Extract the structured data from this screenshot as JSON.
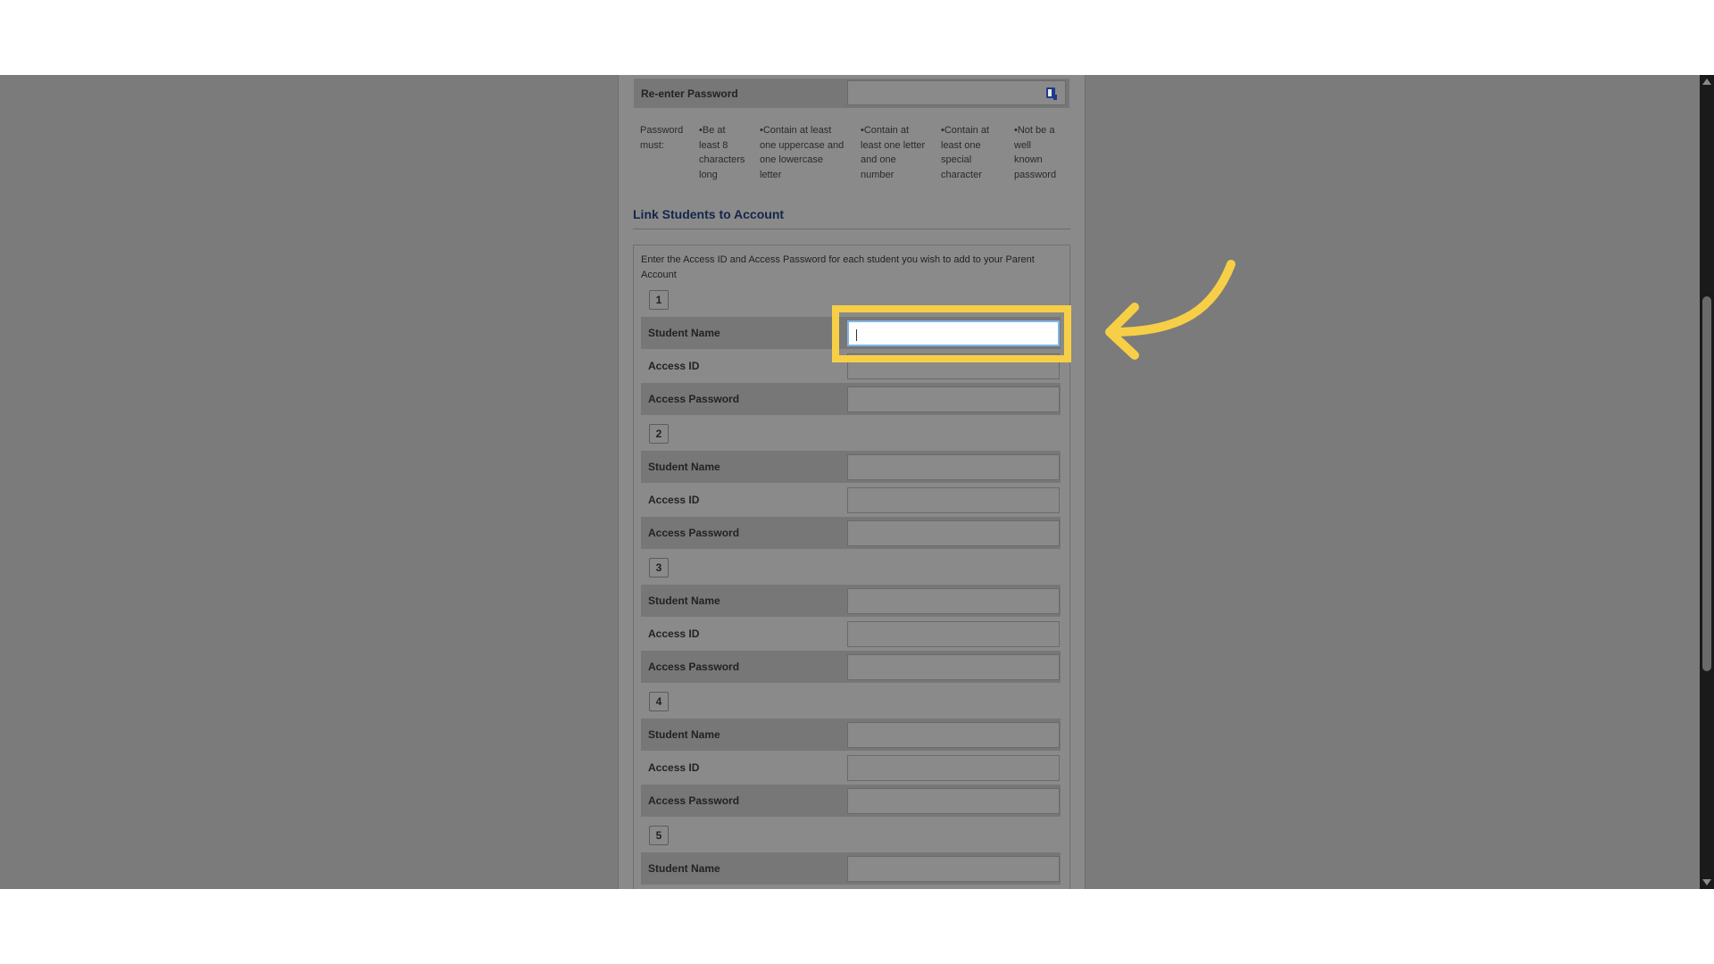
{
  "form": {
    "reenter_password_label": "Re-enter Password",
    "password_rules": {
      "intro": [
        "Password",
        "must:"
      ],
      "items": [
        [
          "•Be at",
          "least 8",
          "characters",
          "long"
        ],
        [
          "•Contain at least",
          "one uppercase and",
          "one lowercase",
          "letter"
        ],
        [
          "•Contain at",
          "least one letter",
          "and one",
          "number"
        ],
        [
          "•Contain at",
          "least one",
          "special",
          "character"
        ],
        [
          "•Not be a",
          "well",
          "known",
          "password"
        ]
      ]
    },
    "link_students_title": "Link Students to Account",
    "link_students_intro": "Enter the Access ID and Access Password for each student you wish to add to your Parent Account",
    "field_labels": {
      "student_name": "Student Name",
      "access_id": "Access ID",
      "access_password": "Access Password"
    },
    "student_numbers": [
      "1",
      "2",
      "3",
      "4",
      "5"
    ]
  },
  "annotation": {
    "highlight_color": "#f7cf46",
    "target": "student-1-name-input"
  },
  "icons": {
    "password_field_icon": "key-icon"
  }
}
